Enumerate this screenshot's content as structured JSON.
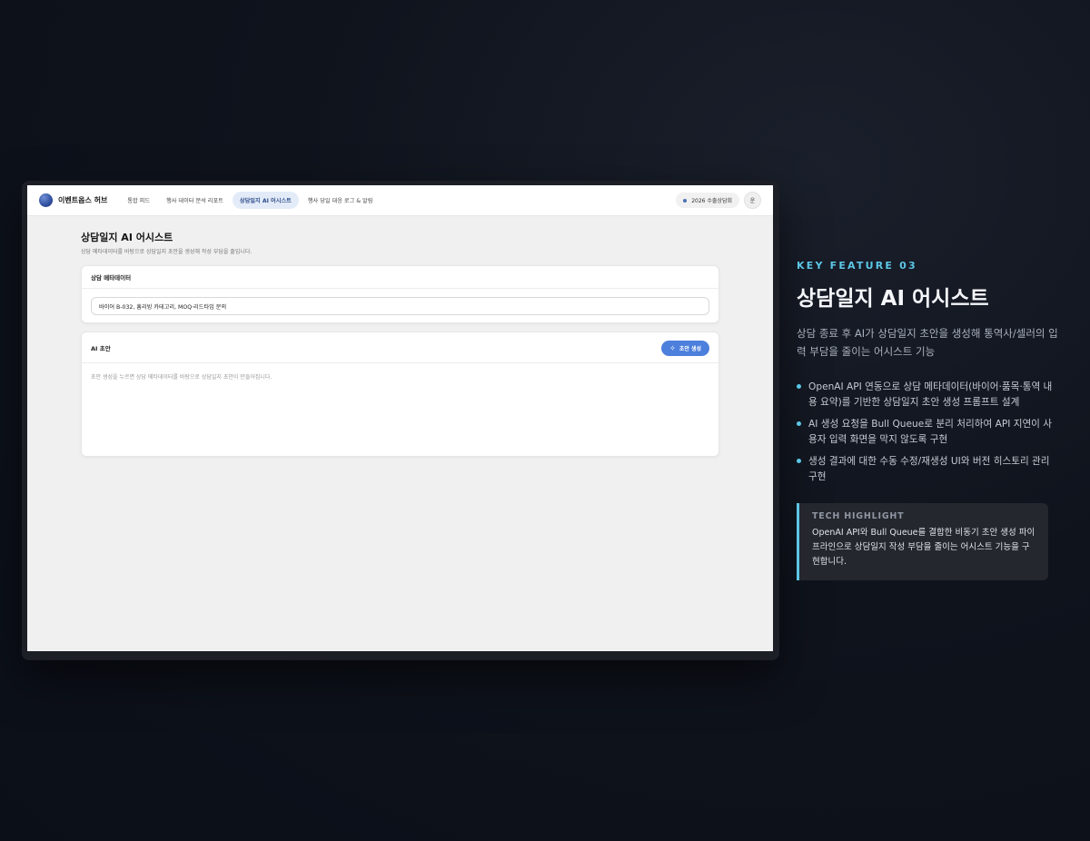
{
  "nav": {
    "brand": "이벤트옵스 허브",
    "items": [
      {
        "label": "통합 피드",
        "active": false
      },
      {
        "label": "행사 데이터 분석 리포트",
        "active": false
      },
      {
        "label": "상담일지 AI 어시스트",
        "active": true
      },
      {
        "label": "행사 당일 대응 로그 & 알림",
        "active": false
      }
    ],
    "event_chip": "2026 수출상담회",
    "avatar": "운"
  },
  "page": {
    "title": "상담일지 AI 어시스트",
    "description": "상담 메타데이터를 바탕으로 상담일지 초안을 생성해 작성 부담을 줄입니다."
  },
  "metadata_card": {
    "title": "상담 메타데이터",
    "input_value": "바이어 B-032, 홈리빙 카테고리, MOQ·리드타임 문의"
  },
  "draft_card": {
    "title": "AI 초안",
    "button_label": "초안 생성",
    "hint": "초안 생성을 누르면 상담 메타데이터를 바탕으로 상담일지 초안이 만들어집니다."
  },
  "feature": {
    "eyebrow": "KEY FEATURE 03",
    "title": "상담일지 AI 어시스트",
    "description": "상담 종료 후 AI가 상담일지 초안을 생성해 통역사/셀러의 입력 부담을 줄이는 어시스트 기능",
    "bullets": [
      "OpenAI API 연동으로 상담 메타데이터(바이어·품목·통역 내용 요약)를 기반한 상담일지 초안 생성 프롬프트 설계",
      "AI 생성 요청을 Bull Queue로 분리 처리하여 API 지연이 사용자 입력 화면을 막지 않도록 구현",
      "생성 결과에 대한 수동 수정/재생성 UI와 버전 히스토리 관리 구현"
    ],
    "tech_label": "TECH HIGHLIGHT",
    "tech_text": "OpenAI API와 Bull Queue를 결합한 비동기 초안 생성 파이프라인으로 상담일지 작성 부담을 줄이는 어시스트 기능을 구현합니다."
  },
  "colors": {
    "accent": "#5cc6e6",
    "primary_button": "#4d7fdc",
    "background": "#0f131c"
  }
}
